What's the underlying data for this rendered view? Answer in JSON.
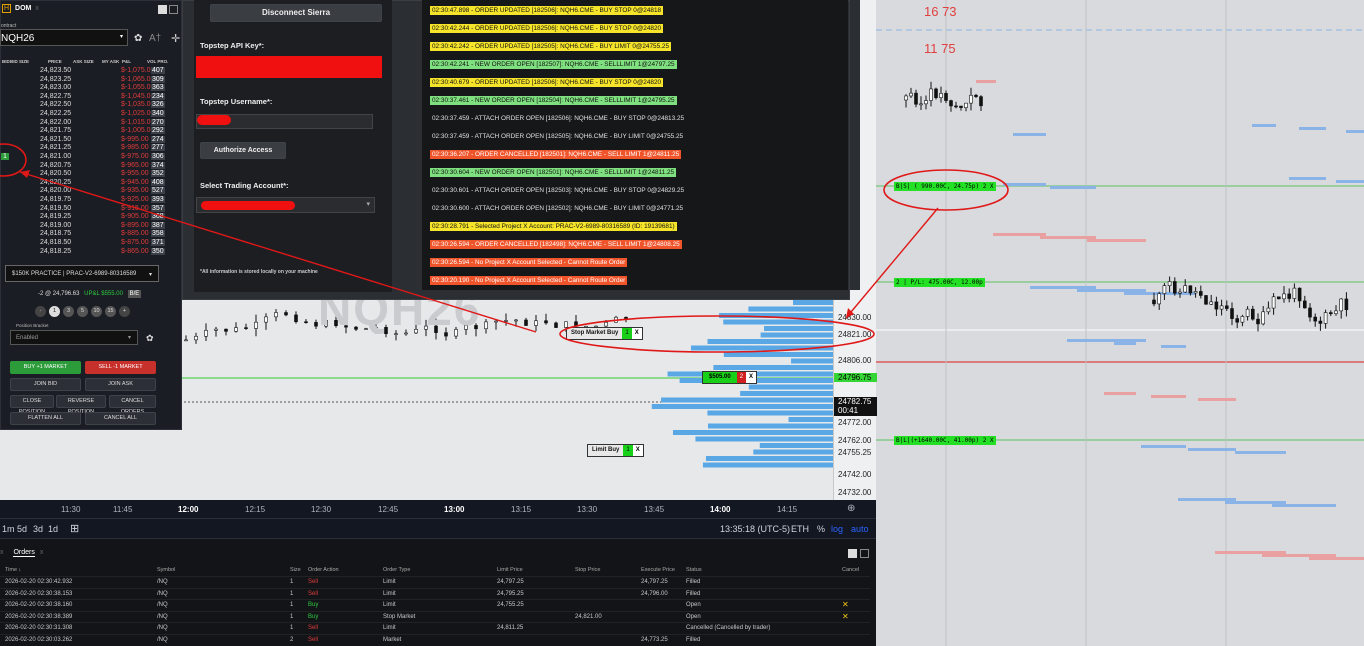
{
  "dom": {
    "title": "DOM",
    "tab_close": "x",
    "contract_label": "ontract",
    "symbol": "NQH26",
    "font_size_icon": "A†",
    "headers": [
      "BID",
      "BID SIZE",
      "PRICE",
      "ASK SIZE",
      "MY ASK",
      "P&L",
      "VOL PRO."
    ],
    "rows": [
      {
        "price": "24,823.50",
        "pnl": "$-1,075.00",
        "vol": "407"
      },
      {
        "price": "24,823.25",
        "pnl": "$-1,065.00",
        "vol": "309"
      },
      {
        "price": "24,823.00",
        "pnl": "$-1,055.00",
        "vol": "363"
      },
      {
        "price": "24,822.75",
        "pnl": "$-1,045.00",
        "vol": "234"
      },
      {
        "price": "24,822.50",
        "pnl": "$-1,035.00",
        "vol": "326"
      },
      {
        "price": "24,822.25",
        "pnl": "$-1,025.00",
        "vol": "340"
      },
      {
        "price": "24,822.00",
        "pnl": "$-1,015.00",
        "vol": "270"
      },
      {
        "price": "24,821.75",
        "pnl": "$-1,005.00",
        "vol": "292"
      },
      {
        "price": "24,821.50",
        "pnl": "$-995.00",
        "vol": "274"
      },
      {
        "price": "24,821.25",
        "pnl": "$-985.00",
        "vol": "277"
      },
      {
        "price": "24,821.00",
        "pnl": "$-975.00",
        "vol": "306"
      },
      {
        "price": "24,820.75",
        "pnl": "$-965.00",
        "vol": "374"
      },
      {
        "price": "24,820.50",
        "pnl": "$-955.00",
        "vol": "352"
      },
      {
        "price": "24,820.25",
        "pnl": "$-945.00",
        "vol": "408"
      },
      {
        "price": "24,820.00",
        "pnl": "$-935.00",
        "vol": "527"
      },
      {
        "price": "24,819.75",
        "pnl": "$-925.00",
        "vol": "393"
      },
      {
        "price": "24,819.50",
        "pnl": "$-915.00",
        "vol": "357"
      },
      {
        "price": "24,819.25",
        "pnl": "$-905.00",
        "vol": "368"
      },
      {
        "price": "24,819.00",
        "pnl": "$-895.00",
        "vol": "387"
      },
      {
        "price": "24,818.75",
        "pnl": "$-885.00",
        "vol": "358"
      },
      {
        "price": "24,818.50",
        "pnl": "$-875.00",
        "vol": "371"
      },
      {
        "price": "24,818.25",
        "pnl": "$-865.00",
        "vol": "350"
      }
    ],
    "bid_marker": "1",
    "account": "$150K PRACTICE | PRAC-V2-6989-80316589",
    "position": "-2 @ 24,796.63",
    "upl": "UP&L $555.00",
    "be": "B/E",
    "qty_minus": "-",
    "qtys": [
      "1",
      "3",
      "5",
      "10",
      "15"
    ],
    "qty_plus": "+",
    "bracket_label": "Position Bracket",
    "bracket_value": "Enabled",
    "buy_market": "BUY +1 MARKET",
    "sell_market": "SELL -1 MARKET",
    "join_bid": "JOIN BID",
    "join_ask": "JOIN ASK",
    "close_position": "CLOSE POSITION",
    "reverse_position": "REVERSE POSITION",
    "cancel_orders": "CANCEL ORDERS",
    "flatten_all": "FLATTEN ALL",
    "cancel_all": "CANCEL ALL"
  },
  "settings": {
    "disconnect": "Disconnect Sierra",
    "api_key_label": "Topstep API Key*:",
    "username_label": "Topstep Username*:",
    "authorize": "Authorize Access",
    "account_label": "Select Trading Account*:",
    "note": "*All information is stored locally on your machine"
  },
  "logs": [
    {
      "text": "02:30:47.898 - ORDER UPDATED [182506]: NQH6.CME - BUY STOP 0@24818",
      "color": "#f5e42a"
    },
    {
      "text": "02:30:42.244 - ORDER UPDATED [182506]: NQH6.CME - BUY STOP 0@24820",
      "color": "#f5e42a"
    },
    {
      "text": "02:30:42.242 - ORDER UPDATED [182505]: NQH6.CME - BUY LIMIT 0@24755.25",
      "color": "#f5e42a"
    },
    {
      "text": "02:30:42.241 - NEW ORDER OPEN [182507]: NQH6.CME - SELLLIMIT 1@24797.25",
      "color": "#7fe07f"
    },
    {
      "text": "02:30:40.679 - ORDER UPDATED [182506]: NQH6.CME - BUY STOP 0@24820",
      "color": "#f5e42a"
    },
    {
      "text": "02:30:37.461 - NEW ORDER OPEN [182504]: NQH6.CME - SELLLIMIT 1@24795.25",
      "color": "#7fe07f"
    },
    {
      "text": "02:30:37.459 - ATTACH ORDER OPEN [182506]: NQH6.CME - BUY STOP 0@24813.25",
      "color": "#d8d8d8"
    },
    {
      "text": "02:30:37.459 - ATTACH ORDER OPEN [182505]: NQH6.CME - BUY LIMIT 0@24755.25",
      "color": "#d8d8d8"
    },
    {
      "text": "02:30:36.207 - ORDER CANCELLED [182501]: NQH6.CME - SELL LIMIT 1@24811.25",
      "color": "#f0542b"
    },
    {
      "text": "02:30:30.604 - NEW ORDER OPEN [182501]: NQH6.CME - SELLLIMIT 1@24811.25",
      "color": "#7fe07f"
    },
    {
      "text": "02:30:30.601 - ATTACH ORDER OPEN [182503]: NQH6.CME - BUY STOP 0@24829.25",
      "color": "#d8d8d8"
    },
    {
      "text": "02:30:30.600 - ATTACH ORDER OPEN [182502]: NQH6.CME - BUY LIMIT 0@24771.25",
      "color": "#d8d8d8"
    },
    {
      "text": "02:30:28.791 - Selected Project X Account: PRAC-V2-6989-80316589 (ID: 19139681)",
      "color": "#f5e42a"
    },
    {
      "text": "02:30:26.594 - ORDER CANCELLED [182498]: NQH6.CME - SELL LIMIT 1@24808.25",
      "color": "#f0542b"
    },
    {
      "text": "02:30:26.594 - No Project X Account Selected - Cannot Route Order",
      "color": "#f0542b"
    },
    {
      "text": "02:30:20.190 - No Project X Account Selected - Cannot Route Order",
      "color": "#f0542b"
    }
  ],
  "chart": {
    "watermark": "NQH26",
    "price_axis": [
      "24830.00",
      "24821.00",
      "24806.00",
      "24796.75",
      "24782.75",
      "00:41",
      "24772.00",
      "24762.00",
      "24755.25",
      "24742.00",
      "24732.00"
    ],
    "time_axis": [
      "11:30",
      "11:45",
      "12:00",
      "12:15",
      "12:30",
      "12:45",
      "13:00",
      "13:15",
      "13:30",
      "13:45",
      "14:00",
      "14:15"
    ],
    "stop_market": {
      "label": "Stop Market Buy",
      "qty": "1",
      "close": "X"
    },
    "position_tag": {
      "label": "$505.00",
      "qty": "2",
      "close": "X"
    },
    "limit_buy": {
      "label": "Limit Buy",
      "qty": "1",
      "close": "X"
    },
    "timeframes": [
      "1m",
      "5d",
      "3d",
      "1d"
    ],
    "clock": "13:35:18 (UTC-5)",
    "session": "ETH",
    "pct": "%",
    "log": "log",
    "auto": "auto"
  },
  "right_chart": {
    "num1": "16 73",
    "num2": "11 75",
    "tag1": "B|S| ( 990.00C, 24.75p) 2 X",
    "tag2": "2 | P/L: 475.00C, 12.00p",
    "tag3": "B|L|(+1640.00C, 41.00p) 2 X"
  },
  "orders": {
    "tab_prev": "x",
    "title": "Orders",
    "tab_close": "x",
    "columns": [
      "Time ↓",
      "Symbol",
      "Size",
      "Order Action",
      "Order Type",
      "Limit Price",
      "Stop Price",
      "Execute Price",
      "Status",
      "Cancel"
    ],
    "rows": [
      {
        "time": "2026-02-20 02:30:42.932",
        "symbol": "/NQ",
        "size": "1",
        "action": "Sell",
        "type": "Limit",
        "limit": "24,797.25",
        "stop": "",
        "exec": "24,797.25",
        "status": "Filled",
        "cancel": ""
      },
      {
        "time": "2026-02-20 02:30:38.153",
        "symbol": "/NQ",
        "size": "1",
        "action": "Sell",
        "type": "Limit",
        "limit": "24,795.25",
        "stop": "",
        "exec": "24,796.00",
        "status": "Filled",
        "cancel": ""
      },
      {
        "time": "2026-02-20 02:30:38.160",
        "symbol": "/NQ",
        "size": "1",
        "action": "Buy",
        "type": "Limit",
        "limit": "24,755.25",
        "stop": "",
        "exec": "",
        "status": "Open",
        "cancel": "✕"
      },
      {
        "time": "2026-02-20 02:30:38.389",
        "symbol": "/NQ",
        "size": "1",
        "action": "Buy",
        "type": "Stop Market",
        "limit": "",
        "stop": "24,821.00",
        "exec": "",
        "status": "Open",
        "cancel": "✕"
      },
      {
        "time": "2026-02-20 02:30:31.308",
        "symbol": "/NQ",
        "size": "1",
        "action": "Sell",
        "type": "Limit",
        "limit": "24,811.25",
        "stop": "",
        "exec": "",
        "status": "Cancelled (Cancelled by trader)",
        "cancel": ""
      },
      {
        "time": "2026-02-20 02:30:03.262",
        "symbol": "/NQ",
        "size": "2",
        "action": "Sell",
        "type": "Market",
        "limit": "",
        "stop": "",
        "exec": "24,773.25",
        "status": "Filled",
        "cancel": ""
      }
    ]
  }
}
